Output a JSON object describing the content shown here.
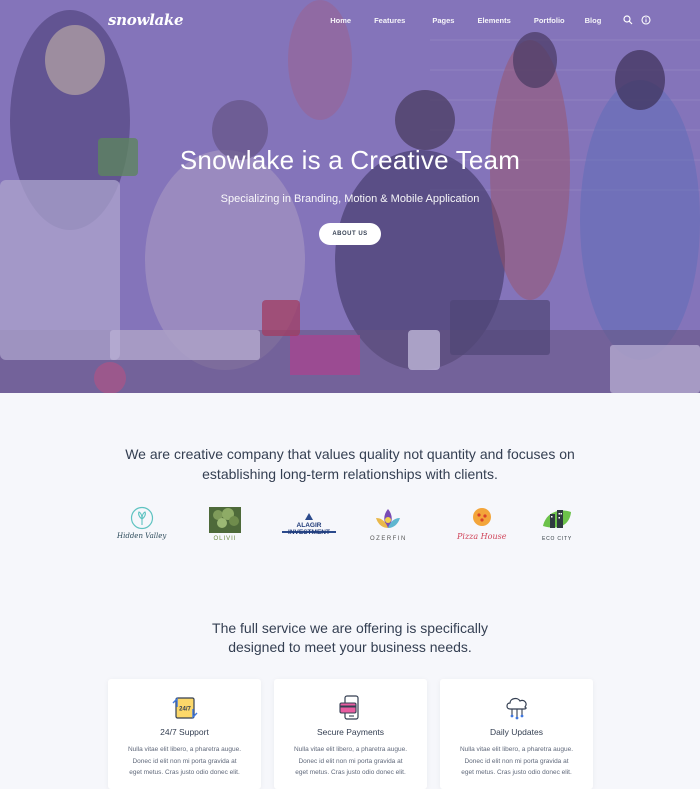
{
  "brand": {
    "logo": "snowlake"
  },
  "nav": {
    "items": [
      "Home",
      "Features",
      "Pages",
      "Elements",
      "Portfolio",
      "Blog"
    ]
  },
  "hero": {
    "title": "Snowlake is a Creative Team",
    "subtitle": "Specializing in Branding, Motion & Mobile Application",
    "button": "ABOUT US"
  },
  "intro": {
    "line1": "We are creative company that values quality not quantity and focuses on",
    "line2": "establishing long-term relationships with clients."
  },
  "clients": [
    {
      "name": "Hidden Valley",
      "icon": "hidden-valley-logo"
    },
    {
      "name": "OLIVII",
      "icon": "olivii-logo"
    },
    {
      "name": "ALAGIR INVESTMENT",
      "icon": "alagir-investment-logo"
    },
    {
      "name": "OZERFIN",
      "icon": "ozerfin-logo"
    },
    {
      "name": "Pizza House",
      "icon": "pizza-house-logo"
    },
    {
      "name": "ECO CITY",
      "icon": "eco-city-logo"
    }
  ],
  "services": {
    "line1": "The full service we are offering is specifically",
    "line2": "designed to meet your business needs.",
    "cards": [
      {
        "title": "24/7 Support",
        "icon": "support-24-7-icon",
        "line1": "Nulla vitae elit libero, a pharetra augue.",
        "line2": "Donec id elit non mi porta gravida at",
        "line3": "eget metus. Cras justo odio donec elit."
      },
      {
        "title": "Secure Payments",
        "icon": "secure-payments-icon",
        "line1": "Nulla vitae elit libero, a pharetra augue.",
        "line2": "Donec id elit non mi porta gravida at",
        "line3": "eget metus. Cras justo odio donec elit."
      },
      {
        "title": "Daily Updates",
        "icon": "daily-updates-icon",
        "line1": "Nulla vitae elit libero, a pharetra augue.",
        "line2": "Donec id elit non mi porta gravida at",
        "line3": "eget metus. Cras justo odio donec elit."
      }
    ]
  },
  "colors": {
    "text": "#343f52",
    "muted": "#60697b",
    "hero_overlay": "#7463ad",
    "background": "#f6f7fb"
  }
}
